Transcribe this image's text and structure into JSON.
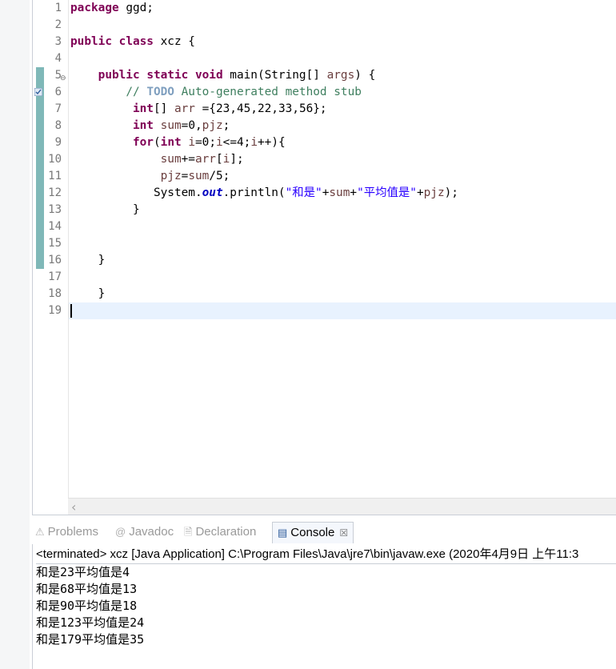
{
  "editor": {
    "line_numbers": [
      "1",
      "2",
      "3",
      "4",
      "5",
      "6",
      "7",
      "8",
      "9",
      "10",
      "11",
      "12",
      "13",
      "14",
      "15",
      "16",
      "17",
      "18",
      "19"
    ],
    "fold_marker": "⊖",
    "lines": [
      [
        {
          "t": "package",
          "c": "kw"
        },
        {
          "t": " ggd;"
        }
      ],
      [],
      [
        {
          "t": "public",
          "c": "kw"
        },
        {
          "t": " "
        },
        {
          "t": "class",
          "c": "kw"
        },
        {
          "t": " xcz {"
        }
      ],
      [],
      [
        {
          "t": "    "
        },
        {
          "t": "public",
          "c": "kw"
        },
        {
          "t": " "
        },
        {
          "t": "static",
          "c": "kw"
        },
        {
          "t": " "
        },
        {
          "t": "void",
          "c": "kw"
        },
        {
          "t": " main(String[] "
        },
        {
          "t": "args",
          "c": "var"
        },
        {
          "t": ") {"
        }
      ],
      [
        {
          "t": "        "
        },
        {
          "t": "// ",
          "c": "cm"
        },
        {
          "t": "TODO",
          "c": "todo"
        },
        {
          "t": " Auto-generated method stub",
          "c": "cm"
        }
      ],
      [
        {
          "t": "         "
        },
        {
          "t": "int",
          "c": "kw"
        },
        {
          "t": "[] "
        },
        {
          "t": "arr",
          "c": "var"
        },
        {
          "t": " ={23,45,22,33,56};"
        }
      ],
      [
        {
          "t": "         "
        },
        {
          "t": "int",
          "c": "kw"
        },
        {
          "t": " "
        },
        {
          "t": "sum",
          "c": "var"
        },
        {
          "t": "=0,"
        },
        {
          "t": "pjz",
          "c": "var"
        },
        {
          "t": ";"
        }
      ],
      [
        {
          "t": "         "
        },
        {
          "t": "for",
          "c": "kw"
        },
        {
          "t": "("
        },
        {
          "t": "int",
          "c": "kw"
        },
        {
          "t": " "
        },
        {
          "t": "i",
          "c": "var"
        },
        {
          "t": "=0;"
        },
        {
          "t": "i",
          "c": "var"
        },
        {
          "t": "<=4;"
        },
        {
          "t": "i",
          "c": "var"
        },
        {
          "t": "++){"
        }
      ],
      [
        {
          "t": "             "
        },
        {
          "t": "sum",
          "c": "var"
        },
        {
          "t": "+="
        },
        {
          "t": "arr",
          "c": "var"
        },
        {
          "t": "["
        },
        {
          "t": "i",
          "c": "var"
        },
        {
          "t": "];"
        }
      ],
      [
        {
          "t": "             "
        },
        {
          "t": "pjz",
          "c": "var"
        },
        {
          "t": "="
        },
        {
          "t": "sum",
          "c": "var"
        },
        {
          "t": "/5;"
        }
      ],
      [
        {
          "t": "            System."
        },
        {
          "t": "out",
          "c": "fld"
        },
        {
          "t": ".println("
        },
        {
          "t": "\"和是\"",
          "c": "str"
        },
        {
          "t": "+"
        },
        {
          "t": "sum",
          "c": "var"
        },
        {
          "t": "+"
        },
        {
          "t": "\"平均值是\"",
          "c": "str"
        },
        {
          "t": "+"
        },
        {
          "t": "pjz",
          "c": "var"
        },
        {
          "t": ");"
        }
      ],
      [
        {
          "t": "         }"
        }
      ],
      [],
      [],
      [
        {
          "t": "    }"
        }
      ],
      [],
      [
        {
          "t": "    }"
        }
      ],
      []
    ]
  },
  "tabs": [
    {
      "label": "Problems",
      "icon": "problems-icon",
      "glyph": "⚠",
      "active": false
    },
    {
      "label": "Javadoc",
      "icon": "javadoc-icon",
      "glyph": "@",
      "active": false
    },
    {
      "label": "Declaration",
      "icon": "declaration-icon",
      "glyph": "🗎",
      "active": false
    },
    {
      "label": "Console",
      "icon": "console-icon",
      "glyph": "▤",
      "active": true
    }
  ],
  "tab_close_glyph": "☒",
  "console": {
    "status": "<terminated> xcz [Java Application] C:\\Program Files\\Java\\jre7\\bin\\javaw.exe (2020年4月9日 上午11:3",
    "output": [
      "和是23平均值是4",
      "和是68平均值是13",
      "和是90平均值是18",
      "和是123平均值是24",
      "和是179平均值是35"
    ]
  },
  "colors": {
    "keyword": "#7f0055",
    "comment": "#3f7f5f",
    "string": "#2a00ff",
    "current_line": "#e8f2fe"
  }
}
